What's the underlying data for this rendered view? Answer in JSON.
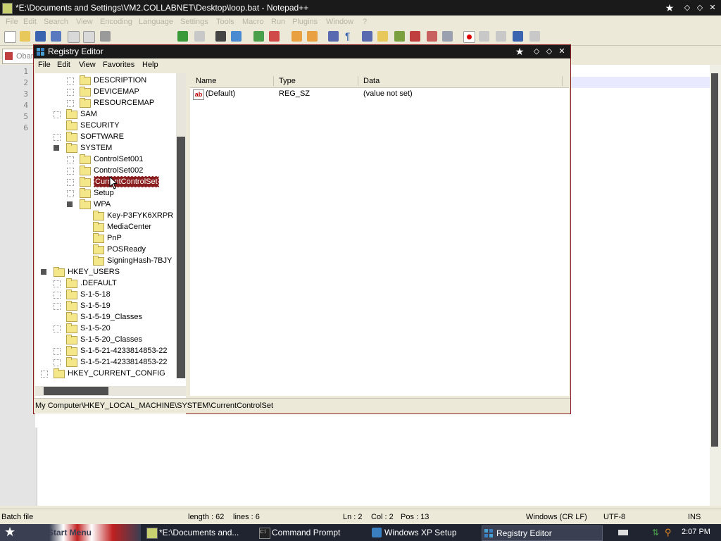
{
  "notepad": {
    "title": "*E:\\Documents and Settings\\VM2.COLLABNET\\Desktop\\loop.bat - Notepad++",
    "menu": [
      "File",
      "Edit",
      "Search",
      "View",
      "Encoding",
      "Language",
      "Settings",
      "Tools",
      "Macro",
      "Run",
      "Plugins",
      "Window",
      "?"
    ],
    "tab_label": "Obar",
    "line_numbers": [
      "1",
      "2",
      "3",
      "4",
      "5",
      "6"
    ],
    "status": {
      "file_type": "Batch file",
      "length": "length : 62",
      "lines": "lines : 6",
      "ln": "Ln : 2",
      "col": "Col : 2",
      "pos": "Pos : 13",
      "eol": "Windows (CR LF)",
      "encoding": "UTF-8",
      "mode": "INS"
    }
  },
  "registry": {
    "title": "Registry Editor",
    "menu": [
      "File",
      "Edit",
      "View",
      "Favorites",
      "Help"
    ],
    "tree": [
      {
        "label": "DESCRIPTION",
        "level": 3,
        "exp": "closed"
      },
      {
        "label": "DEVICEMAP",
        "level": 3,
        "exp": "closed"
      },
      {
        "label": "RESOURCEMAP",
        "level": 3,
        "exp": "closed"
      },
      {
        "label": "SAM",
        "level": 2,
        "exp": "closed"
      },
      {
        "label": "SECURITY",
        "level": 2,
        "exp": "none"
      },
      {
        "label": "SOFTWARE",
        "level": 2,
        "exp": "closed"
      },
      {
        "label": "SYSTEM",
        "level": 2,
        "exp": "open"
      },
      {
        "label": "ControlSet001",
        "level": 3,
        "exp": "closed"
      },
      {
        "label": "ControlSet002",
        "level": 3,
        "exp": "closed"
      },
      {
        "label": "CurrentControlSet",
        "level": 3,
        "exp": "closed",
        "selected": true
      },
      {
        "label": "Setup",
        "level": 3,
        "exp": "closed"
      },
      {
        "label": "WPA",
        "level": 3,
        "exp": "open"
      },
      {
        "label": "Key-P3FYK6XRPR",
        "level": 4,
        "exp": "none"
      },
      {
        "label": "MediaCenter",
        "level": 4,
        "exp": "none"
      },
      {
        "label": "PnP",
        "level": 4,
        "exp": "none"
      },
      {
        "label": "POSReady",
        "level": 4,
        "exp": "none"
      },
      {
        "label": "SigningHash-7BJY",
        "level": 4,
        "exp": "none"
      },
      {
        "label": "HKEY_USERS",
        "level": 1,
        "exp": "open"
      },
      {
        "label": ".DEFAULT",
        "level": 2,
        "exp": "closed"
      },
      {
        "label": "S-1-5-18",
        "level": 2,
        "exp": "closed"
      },
      {
        "label": "S-1-5-19",
        "level": 2,
        "exp": "closed"
      },
      {
        "label": "S-1-5-19_Classes",
        "level": 2,
        "exp": "none"
      },
      {
        "label": "S-1-5-20",
        "level": 2,
        "exp": "closed"
      },
      {
        "label": "S-1-5-20_Classes",
        "level": 2,
        "exp": "none"
      },
      {
        "label": "S-1-5-21-4233814853-22",
        "level": 2,
        "exp": "closed"
      },
      {
        "label": "S-1-5-21-4233814853-22",
        "level": 2,
        "exp": "closed"
      },
      {
        "label": "HKEY_CURRENT_CONFIG",
        "level": 1,
        "exp": "closed"
      }
    ],
    "columns": {
      "name": "Name",
      "type": "Type",
      "data": "Data"
    },
    "values": [
      {
        "name": "(Default)",
        "type": "REG_SZ",
        "data": "(value not set)"
      }
    ],
    "status_path": "My Computer\\HKEY_LOCAL_MACHINE\\SYSTEM\\CurrentControlSet"
  },
  "taskbar": {
    "start_label": "Start Menu",
    "tasks": [
      {
        "label": "*E:\\Documents and...",
        "icon": "notepad-icon",
        "active": false
      },
      {
        "label": "Command Prompt",
        "icon": "cmd-icon",
        "active": false
      },
      {
        "label": "Windows XP Setup",
        "icon": "setup-icon",
        "active": false
      },
      {
        "label": "Registry Editor",
        "icon": "regedit-icon",
        "active": true
      }
    ],
    "clock": "2:07 PM"
  },
  "colors": {
    "accent": "#8a1d1d",
    "titlebar": "#1a1a1a",
    "chrome": "#ece9d8"
  }
}
